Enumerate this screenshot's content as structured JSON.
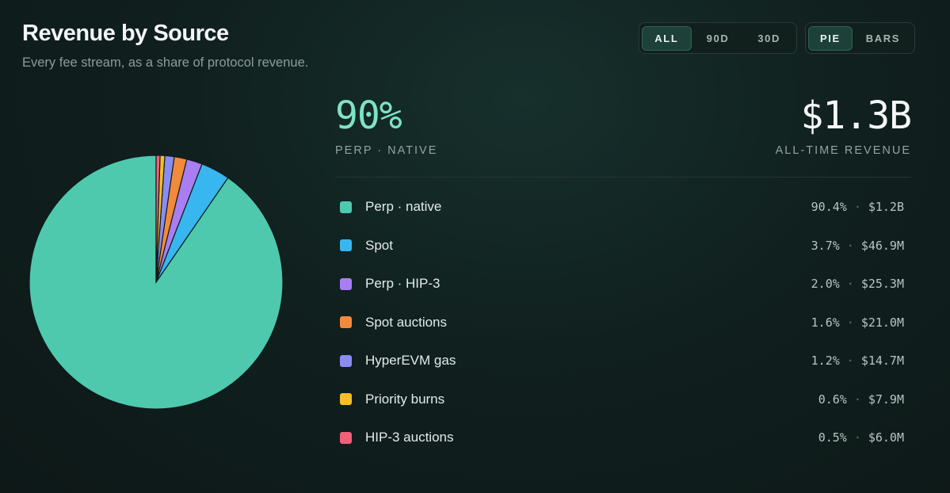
{
  "header": {
    "title": "Revenue by Source",
    "subtitle": "Every fee stream, as a share of protocol revenue."
  },
  "range_toggle": {
    "options": [
      "ALL",
      "90D",
      "30D"
    ],
    "selected": "ALL"
  },
  "view_toggle": {
    "options": [
      "PIE",
      "BARS"
    ],
    "selected": "PIE"
  },
  "headline": {
    "value": "90%",
    "label": "PERP · NATIVE"
  },
  "total": {
    "value": "$1.3B",
    "label": "ALL-TIME REVENUE"
  },
  "colors": {
    "accent": "#7ee3c4",
    "background": "#10201f"
  },
  "legend": [
    {
      "label": "Perp · native",
      "pct": "90.4%",
      "amount": "$1.2B",
      "color": "#4ec9ae"
    },
    {
      "label": "Spot",
      "pct": "3.7%",
      "amount": "$46.9M",
      "color": "#38b6f0"
    },
    {
      "label": "Perp · HIP-3",
      "pct": "2.0%",
      "amount": "$25.3M",
      "color": "#a87ef2"
    },
    {
      "label": "Spot auctions",
      "pct": "1.6%",
      "amount": "$21.0M",
      "color": "#f28a3c"
    },
    {
      "label": "HyperEVM gas",
      "pct": "1.2%",
      "amount": "$14.7M",
      "color": "#8a8cf2"
    },
    {
      "label": "Priority burns",
      "pct": "0.6%",
      "amount": "$7.9M",
      "color": "#f5be2c"
    },
    {
      "label": "HIP-3 auctions",
      "pct": "0.5%",
      "amount": "$6.0M",
      "color": "#f0607a"
    }
  ],
  "chart_data": {
    "type": "pie",
    "categories": [
      "Perp · native",
      "Spot",
      "Perp · HIP-3",
      "Spot auctions",
      "HyperEVM gas",
      "Priority burns",
      "HIP-3 auctions"
    ],
    "values": [
      90.4,
      3.7,
      2.0,
      1.6,
      1.2,
      0.6,
      0.5
    ],
    "colors": [
      "#4ec9ae",
      "#38b6f0",
      "#a87ef2",
      "#f28a3c",
      "#8a8cf2",
      "#f5be2c",
      "#f0607a"
    ],
    "start_angle_deg": 0,
    "direction": "counterclockwise",
    "title": ""
  }
}
